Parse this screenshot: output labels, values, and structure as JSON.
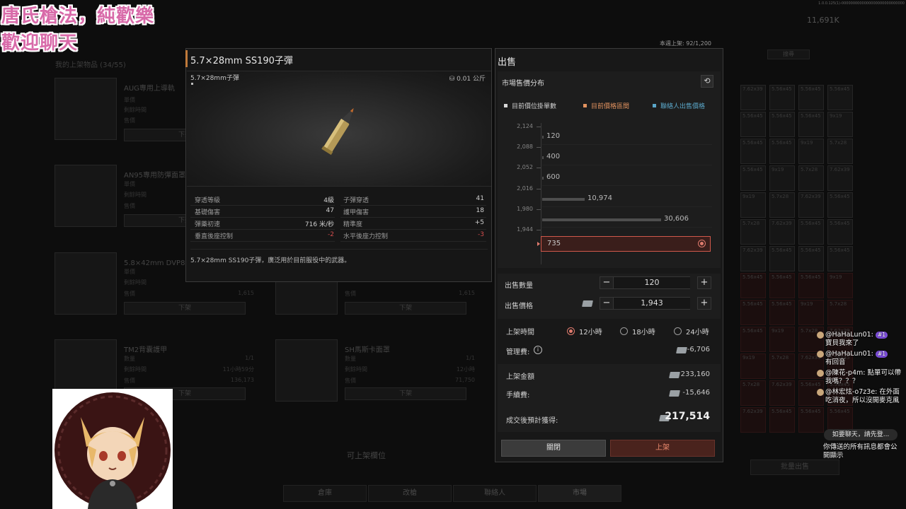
{
  "overlay": {
    "caption_line1": "唐氏槍法，純歡樂",
    "caption_line2": "歡迎聊天"
  },
  "header": {
    "currency": "11,691K",
    "listing_limit": "本週上架: 92/1,200",
    "search_label": "搜尋"
  },
  "my_listings": {
    "label": "我的上架物品 (34/55)",
    "cards": [
      {
        "title": "AUG專用上導軌",
        "lines": [
          "單價",
          "剩餘時間",
          "售價"
        ],
        "values": [
          "",
          "",
          ""
        ],
        "button": "下架"
      },
      {
        "title": "AN95專用防彈面罩",
        "lines": [
          "單價",
          "剩餘時間",
          "售價"
        ],
        "values": [
          "",
          "",
          ""
        ],
        "button": "下架"
      },
      {
        "title": "5.8×42mm DVP88子彈",
        "lines": [
          "單價",
          "剩餘時間",
          "售價"
        ],
        "values": [
          "",
          "",
          "1,615"
        ],
        "button": "下架"
      },
      {
        "title": "",
        "lines": [
          "單價",
          "剩餘時間",
          "售價"
        ],
        "values": [
          "",
          "",
          "1,615"
        ],
        "button": "下架"
      },
      {
        "title": "TM2背囊護甲",
        "lines": [
          "數量",
          "剩餘時間",
          "售價"
        ],
        "values": [
          "1/1",
          "11小時59分",
          "136,173"
        ],
        "button": "下架"
      },
      {
        "title": "SH馬斯卡面罩",
        "lines": [
          "數量",
          "剩餘時間",
          "售價"
        ],
        "values": [
          "1/1",
          "12小時",
          "71,750"
        ],
        "button": "下架"
      }
    ],
    "empty_slot": "可上架欄位",
    "batch_sell": "批量出售"
  },
  "bottom_tabs": [
    "倉庫",
    "改槍",
    "聯絡人",
    "市場"
  ],
  "item": {
    "name": "5.7×28mm SS190子彈",
    "subtitle": "5.7×28mm子彈",
    "weight": "0.01 公斤",
    "stats_left": [
      {
        "label": "穿透等級",
        "value": "4級"
      },
      {
        "label": "基礎傷害",
        "value": "47"
      },
      {
        "label": "彈藥初速",
        "value": "716 米/秒"
      },
      {
        "label": "垂直後座控制",
        "value": "-2"
      }
    ],
    "stats_right": [
      {
        "label": "子彈穿透",
        "value": "41"
      },
      {
        "label": "護甲傷害",
        "value": "18"
      },
      {
        "label": "精準度",
        "value": "+5"
      },
      {
        "label": "水平後座力控制",
        "value": "-3"
      }
    ],
    "description": "5.7×28mm SS190子彈，廣泛用於目前服役中的武器。"
  },
  "sell": {
    "title": "出售",
    "dist_title": "市場售價分布",
    "legend": [
      {
        "label": "目前價位掛單數",
        "color": "#d8d8d8"
      },
      {
        "label": "目前價格區間",
        "color": "#e2925f"
      },
      {
        "label": "聯絡人出售價格",
        "color": "#5aa6c8"
      }
    ],
    "price_ticks": [
      "2,124",
      "2,088",
      "2,052",
      "2,016",
      "1,980",
      "1,944"
    ],
    "distribution": [
      {
        "count": "120",
        "fraction": 0.0
      },
      {
        "count": "400",
        "fraction": 0.0
      },
      {
        "count": "600",
        "fraction": 0.0
      },
      {
        "count": "10,974",
        "fraction": 0.36
      },
      {
        "count": "30,606",
        "fraction": 1.0
      }
    ],
    "my_row_count": "735",
    "quantity_label": "出售數量",
    "quantity": "120",
    "price_label": "出售價格",
    "price": "1,943",
    "duration_label": "上架時間",
    "durations": [
      "12小時",
      "18小時",
      "24小時"
    ],
    "selected_duration": 0,
    "mgmt_fee_label": "管理費:",
    "mgmt_fee": "-6,706",
    "listing_amount_label": "上架金額",
    "listing_amount": "233,160",
    "handling_fee_label": "手續費:",
    "handling_fee": "-15,646",
    "expected_label": "成交後預計獲得:",
    "expected": "217,514",
    "close_button": "關閉",
    "list_button": "上架"
  },
  "chat": {
    "messages": [
      {
        "user": "@HaHaLun01:",
        "badge": "#1",
        "text": "寶貝我來了"
      },
      {
        "user": "@HaHaLun01:",
        "badge": "#1",
        "text": "有回音"
      },
      {
        "user": "@陳花-p4m:",
        "badge": "",
        "text": "點單可以帶我嗎？？？"
      },
      {
        "user": "@林宏炫-o7z3e:",
        "badge": "",
        "text": "在外面吃消夜，所以沒開麥克風"
      }
    ],
    "input_placeholder": "如要聊天，請先登...",
    "notice": "你傳送的所有訊息都會公開顯示"
  }
}
